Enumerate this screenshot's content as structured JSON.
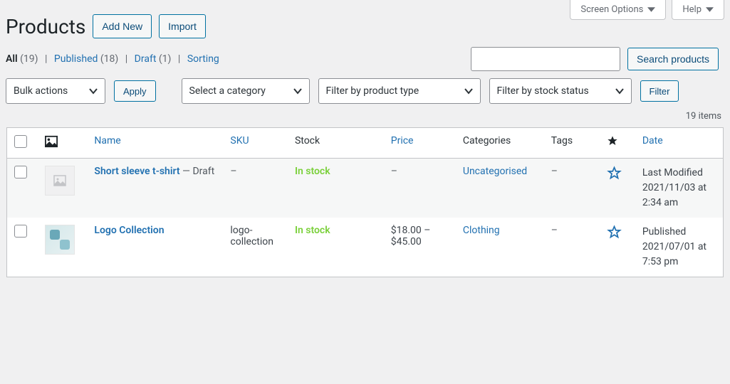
{
  "topright": {
    "screen_options": "Screen Options",
    "help": "Help"
  },
  "header": {
    "title": "Products",
    "add_new": "Add New",
    "import": "Import"
  },
  "views": {
    "all_label": "All",
    "all_count": "(19)",
    "published_label": "Published",
    "published_count": "(18)",
    "draft_label": "Draft",
    "draft_count": "(1)",
    "sorting_label": "Sorting"
  },
  "search": {
    "placeholder": "",
    "button": "Search products"
  },
  "filters": {
    "bulk": "Bulk actions",
    "apply": "Apply",
    "category": "Select a category",
    "ptype": "Filter by product type",
    "stock": "Filter by stock status",
    "filter": "Filter"
  },
  "itemcount": "19 items",
  "columns": {
    "name": "Name",
    "sku": "SKU",
    "stock": "Stock",
    "price": "Price",
    "categories": "Categories",
    "tags": "Tags",
    "date": "Date"
  },
  "rows": [
    {
      "name": "Short sleeve t-shirt",
      "status": " — Draft",
      "sku": "–",
      "stock": "In stock",
      "price": "–",
      "category": "Uncategorised",
      "tags": "–",
      "date": "Last Modified 2021/11/03 at 2:34 am",
      "thumb": "placeholder"
    },
    {
      "name": "Logo Collection",
      "status": "",
      "sku": "logo-collection",
      "stock": "In stock",
      "price": "$18.00 – $45.00",
      "category": "Clothing",
      "tags": "–",
      "date": "Published 2021/07/01 at 7:53 pm",
      "thumb": "logo"
    }
  ]
}
